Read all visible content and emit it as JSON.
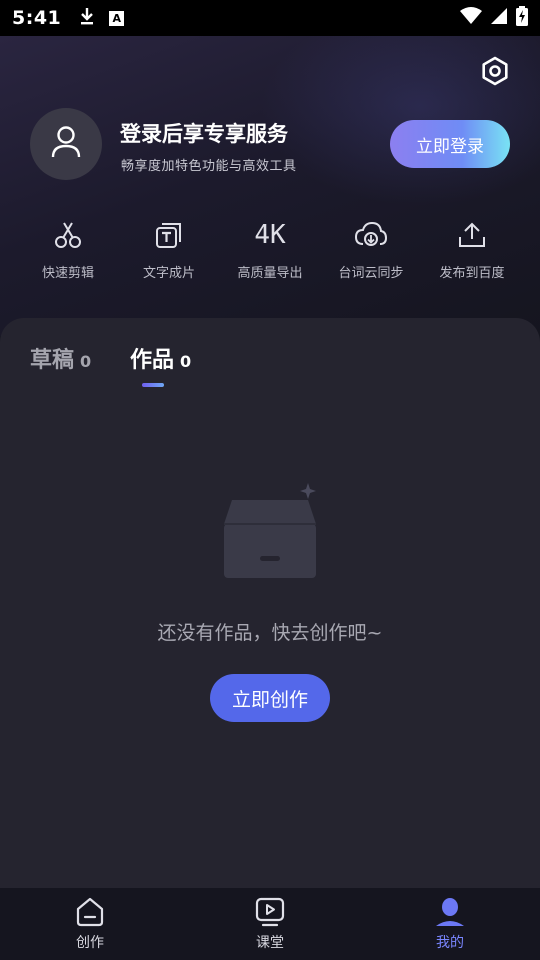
{
  "status_bar": {
    "time": "5:41",
    "left_icons": [
      "download-icon",
      "a-icon"
    ],
    "right_icons": [
      "wifi-icon",
      "signal-icon",
      "battery-charging-icon"
    ],
    "a_icon_text": "A"
  },
  "header": {
    "settings_icon": "settings-hex-icon",
    "avatar_icon": "user-icon",
    "login_title": "登录后享专享服务",
    "login_subtitle": "畅享度加特色功能与高效工具",
    "login_button": "立即登录",
    "features": [
      {
        "icon": "scissors-icon",
        "label": "快速剪辑"
      },
      {
        "icon": "text-frame-icon",
        "label": "文字成片"
      },
      {
        "icon": "4k-icon",
        "label": "高质量导出",
        "icon_text": "4K"
      },
      {
        "icon": "cloud-sync-icon",
        "label": "台词云同步"
      },
      {
        "icon": "upload-icon",
        "label": "发布到百度"
      }
    ]
  },
  "tabs": [
    {
      "label": "草稿",
      "count": "0",
      "active": false
    },
    {
      "label": "作品",
      "count": "0",
      "active": true
    }
  ],
  "empty_state": {
    "icon": "empty-box-icon",
    "message": "还没有作品，快去创作吧~",
    "button": "立即创作"
  },
  "bottom_nav": [
    {
      "icon": "home-icon",
      "label": "创作",
      "active": false
    },
    {
      "icon": "play-tv-icon",
      "label": "课堂",
      "active": false
    },
    {
      "icon": "profile-icon",
      "label": "我的",
      "active": true
    }
  ],
  "colors": {
    "accent": "#5468ea",
    "active_nav": "#7a86ff",
    "background": "#15151f",
    "card": "#25242f"
  }
}
